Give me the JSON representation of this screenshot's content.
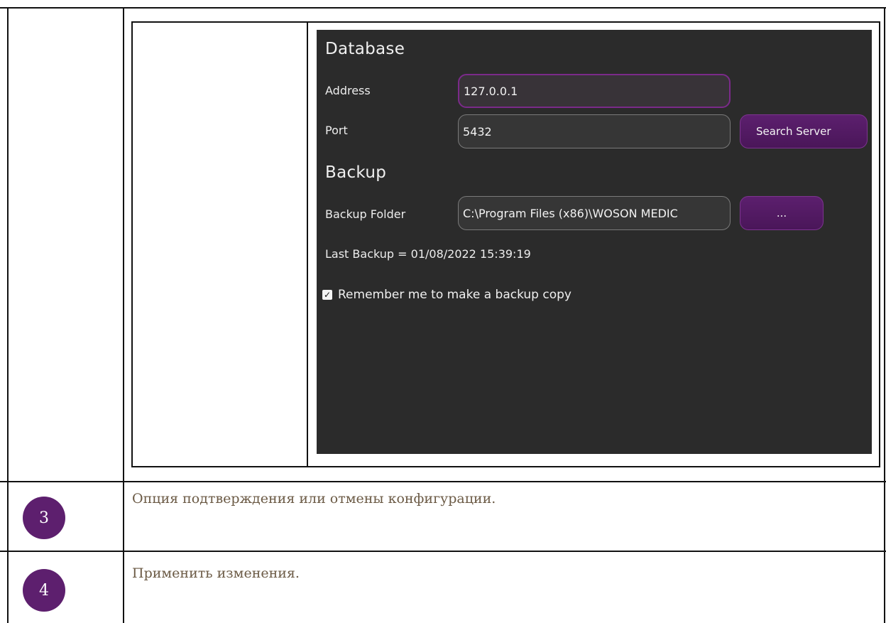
{
  "settings_panel": {
    "database_title": "Database",
    "address_label": "Address",
    "address_value": "127.0.0.1",
    "port_label": "Port",
    "port_value": "5432",
    "search_server_button": "Search Server",
    "backup_title": "Backup",
    "backup_folder_label": "Backup Folder",
    "backup_folder_value": "C:\\Program Files (x86)\\WOSON MEDIC",
    "browse_button": "...",
    "last_backup": "Last Backup =  01/08/2022 15:39:19",
    "remember_checked": true,
    "remember_label": "Remember me to make a backup copy"
  },
  "rows": [
    {
      "number": "3",
      "description": "Опция подтверждения или отмены конфигурации."
    },
    {
      "number": "4",
      "description": "Применить изменения."
    }
  ],
  "colors": {
    "accent": "#5d1f6e",
    "panel_bg": "#2b2b2b",
    "description_text": "#6b5a45"
  }
}
